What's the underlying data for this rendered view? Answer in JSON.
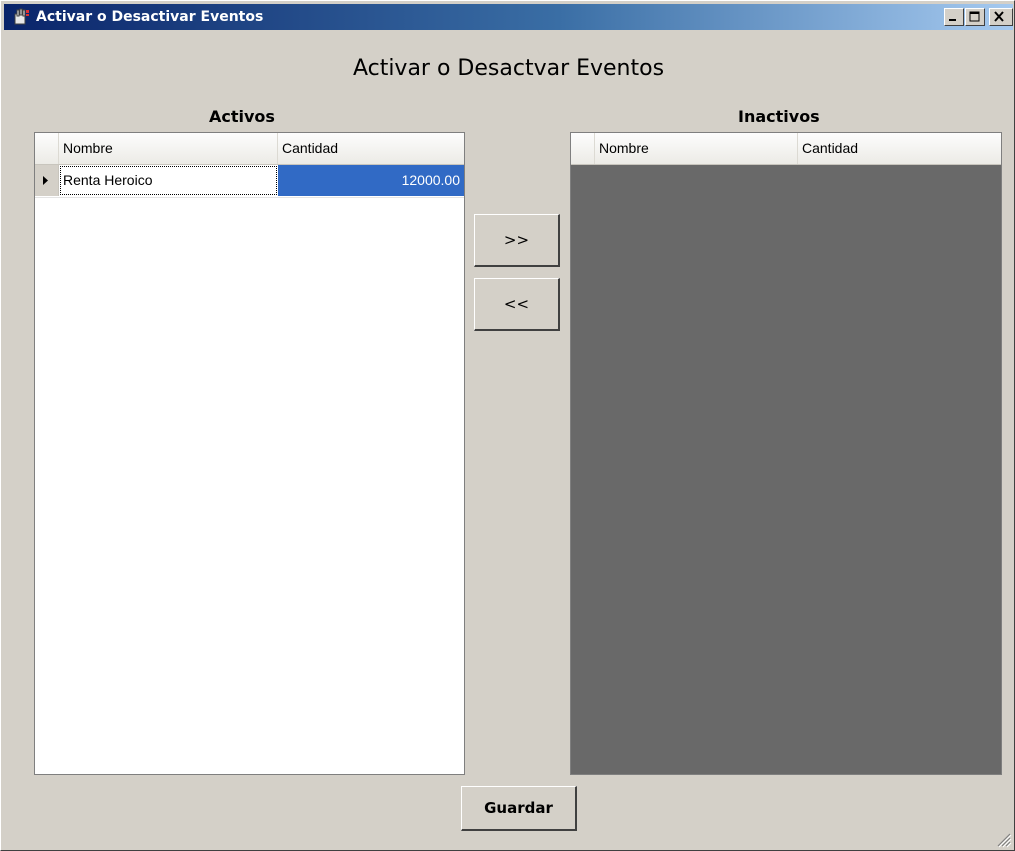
{
  "window": {
    "title": "Activar o Desactivar Eventos"
  },
  "heading": "Activar o Desactvar Eventos",
  "activos": {
    "label": "Activos",
    "columns": [
      "Nombre",
      "Cantidad"
    ],
    "rows": [
      {
        "nombre": "Renta Heroico",
        "cantidad": "12000.00"
      }
    ]
  },
  "inactivos": {
    "label": "Inactivos",
    "columns": [
      "Nombre",
      "Cantidad"
    ],
    "rows": []
  },
  "buttons": {
    "move_right": ">>",
    "move_left": "<<",
    "save": "Guardar"
  },
  "colors": {
    "title_bar_start": "#0a246a",
    "title_bar_end": "#a6caf0",
    "selection": "#316ac5",
    "window_bg": "#d4d0c8",
    "empty_grid_bg": "#696969"
  }
}
